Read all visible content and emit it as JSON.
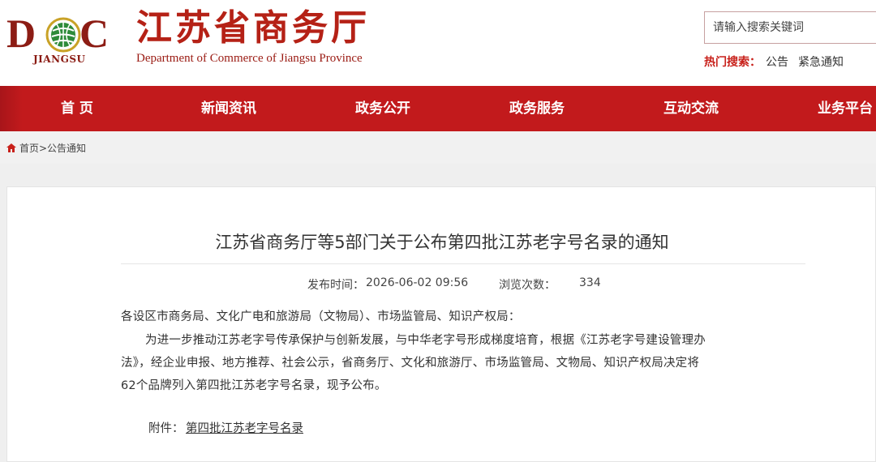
{
  "header": {
    "logo_text": "DOC",
    "logo_sub": "JIANGSU",
    "site_title": "江苏省商务厅",
    "site_title_en": "Department of Commerce of Jiangsu Province",
    "search_placeholder": "请输入搜索关键词",
    "hot_label": "热门搜索：",
    "hot_items": [
      "公告",
      "紧急通知"
    ]
  },
  "nav": {
    "items": [
      "首 页",
      "新闻资讯",
      "政务公开",
      "政务服务",
      "互动交流",
      "业务平台"
    ]
  },
  "breadcrumb": {
    "text": "首页>公告通知"
  },
  "article": {
    "title": "江苏省商务厅等5部门关于公布第四批江苏老字号名录的通知",
    "publish_label": "发布时间：",
    "publish_time": "2026-06-02 09:56",
    "views_label": "浏览次数：",
    "views": "334",
    "salutation": "各设区市商务局、文化广电和旅游局（文物局）、市场监管局、知识产权局：",
    "body_lines": [
      "为进一步推动江苏老字号传承保护与创新发展，与中华老字号形成梯度培育，根据《江苏老字号建设管理办",
      "法》，经企业申报、地方推荐、社会公示，省商务厅、文化和旅游厅、市场监管局、文物局、知识产权局决定将",
      "62个品牌列入第四批江苏老字号名录，现予公布。"
    ],
    "attachment_label": "附件：",
    "attachment_link": "第四批江苏老字号名录"
  },
  "colors": {
    "brand_red": "#c21a1c",
    "title_red": "#b52116",
    "logo_green": "#2e8b3a"
  }
}
